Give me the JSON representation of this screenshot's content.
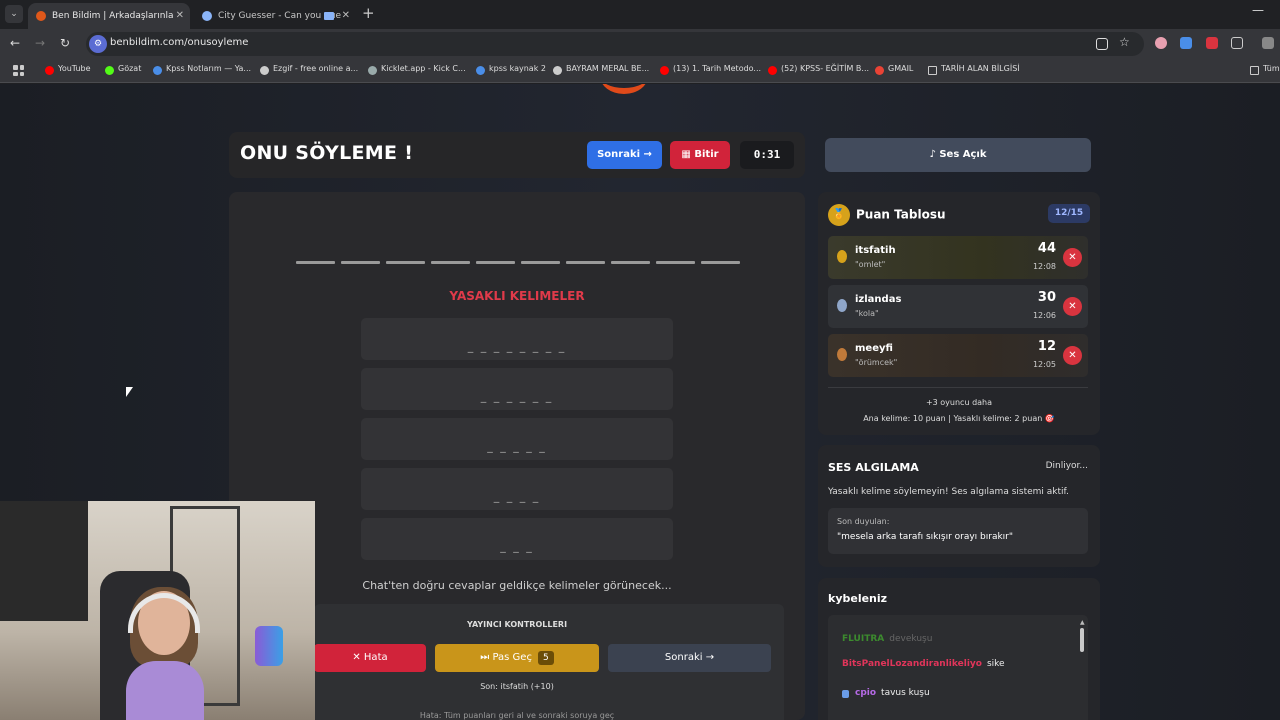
{
  "browser": {
    "tabs": [
      {
        "title": "Ben Bildim | Arkadaşlarınla",
        "active": true,
        "color": "#e0581a"
      },
      {
        "title": "City Guesser - Can you gue",
        "active": false,
        "color": "#8ab4f8"
      }
    ],
    "url": "benbildim.com/onusoyleme",
    "bookmarks": [
      {
        "label": "YouTube",
        "color": "#ff0000"
      },
      {
        "label": "Gözat",
        "color": "#53fc18"
      },
      {
        "label": "Kpss Notlarım — Ya...",
        "color": "#4a8ee8"
      },
      {
        "label": "Ezgif - free online a...",
        "color": "#cccccc"
      },
      {
        "label": "Kicklet.app - Kick C...",
        "color": "#9aa"
      },
      {
        "label": "kpss kaynak 2",
        "color": "#4a8ee8"
      },
      {
        "label": "BAYRAM MERAL BE...",
        "color": "#cccccc"
      },
      {
        "label": "(13) 1. Tarih Metodo...",
        "color": "#ff0000"
      },
      {
        "label": "(52) KPSS- EĞİTİM B...",
        "color": "#ff0000"
      },
      {
        "label": "GMAIL",
        "color": "#ea4335"
      },
      {
        "label": "TARİH ALAN BİLGİSİ",
        "color": "#cccccc"
      },
      {
        "label": "Tüm",
        "color": "#cccccc"
      }
    ]
  },
  "header": {
    "title": "ONU SÖYLEME !",
    "next_label": "Sonraki →",
    "finish_label": "Bitir",
    "timer": "0:31"
  },
  "game": {
    "blank_count": 10,
    "forbidden_title": "YASAKLI KELIMELER",
    "forbidden_words": [
      "_ _ _ _ _ _ _ _",
      "_ _ _ _ _ _",
      "_ _ _ _ _",
      "_ _ _ _",
      "_ _ _"
    ],
    "chat_hint": "Chat'ten doğru cevaplar geldikçe kelimeler görünecek..."
  },
  "controls": {
    "title": "YAYINCI KONTROLLERI",
    "error_label": "✕  Hata",
    "pass_label": "⏭ Pas Geç",
    "pass_count": "5",
    "next_label": "Sonraki →",
    "last": "Son: itsfatih (+10)",
    "hint": "Hata: Tüm puanları geri al ve sonraki soruya geç"
  },
  "sound": {
    "label": "Ses Açık"
  },
  "scoreboard": {
    "title": "Puan Tablosu",
    "count": "12/15",
    "players": [
      {
        "name": "itsfatih",
        "word": "\"omlet\"",
        "score": "44",
        "time": "12:08",
        "medal": "#d6a21b"
      },
      {
        "name": "izlandas",
        "word": "\"kola\"",
        "score": "30",
        "time": "12:06",
        "medal": "#8fa6c9"
      },
      {
        "name": "meeyfi",
        "word": "\"örümcek\"",
        "score": "12",
        "time": "12:05",
        "medal": "#c07a3a"
      }
    ],
    "more": "+3 oyuncu daha",
    "rules": "Ana kelime: 10 puan | Yasaklı kelime: 2 puan 🎯"
  },
  "speech": {
    "title": "SES ALGILAMA",
    "status": "Dinliyor...",
    "description": "Yasaklı kelime söylemeyin! Ses algılama sistemi aktif.",
    "heard_label": "Son duyulan:",
    "heard_text": "\"mesela arka tarafı sıkışır orayı bırakır\""
  },
  "chat": {
    "title": "kybeleniz",
    "messages": [
      {
        "user": "FLUITRA",
        "text": "devekuşu",
        "color": "#3c8a2e"
      },
      {
        "user": "BitsPanelLozandiranlikeliyo",
        "text": "sike",
        "color": "#e0355a"
      },
      {
        "user": "cpio",
        "text": "tavus kuşu",
        "color": "#b66ae6"
      }
    ]
  }
}
